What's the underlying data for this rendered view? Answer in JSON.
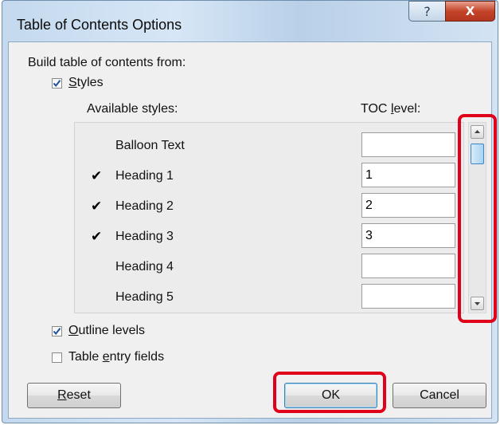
{
  "window": {
    "title": "Table of Contents Options",
    "help_glyph": "?",
    "close_glyph": "X"
  },
  "build_from": {
    "label": "Build table of contents from:",
    "styles": {
      "label_first": "S",
      "label_rest": "tyles",
      "checked": true
    },
    "available_styles_header": "Available styles:",
    "toc_level_header_pre": "TOC ",
    "toc_level_header_u": "l",
    "toc_level_header_post": "evel:",
    "rows": [
      {
        "name": "Balloon Text",
        "checked": false,
        "level": ""
      },
      {
        "name": "Heading 1",
        "checked": true,
        "level": "1"
      },
      {
        "name": "Heading 2",
        "checked": true,
        "level": "2"
      },
      {
        "name": "Heading 3",
        "checked": true,
        "level": "3"
      },
      {
        "name": "Heading 4",
        "checked": false,
        "level": ""
      },
      {
        "name": "Heading 5",
        "checked": false,
        "level": ""
      }
    ],
    "checkmark_glyph": "✔",
    "outline_levels": {
      "label_first": "O",
      "label_rest": "utline levels",
      "checked": true
    },
    "table_entry_fields": {
      "label_pre": "Table ",
      "label_u": "e",
      "label_post": "ntry fields",
      "checked": false
    }
  },
  "buttons": {
    "reset_first": "R",
    "reset_rest": "eset",
    "ok": "OK",
    "cancel": "Cancel"
  },
  "colors": {
    "highlight": "#e0001a",
    "check_blue": "#1d4fa3"
  }
}
